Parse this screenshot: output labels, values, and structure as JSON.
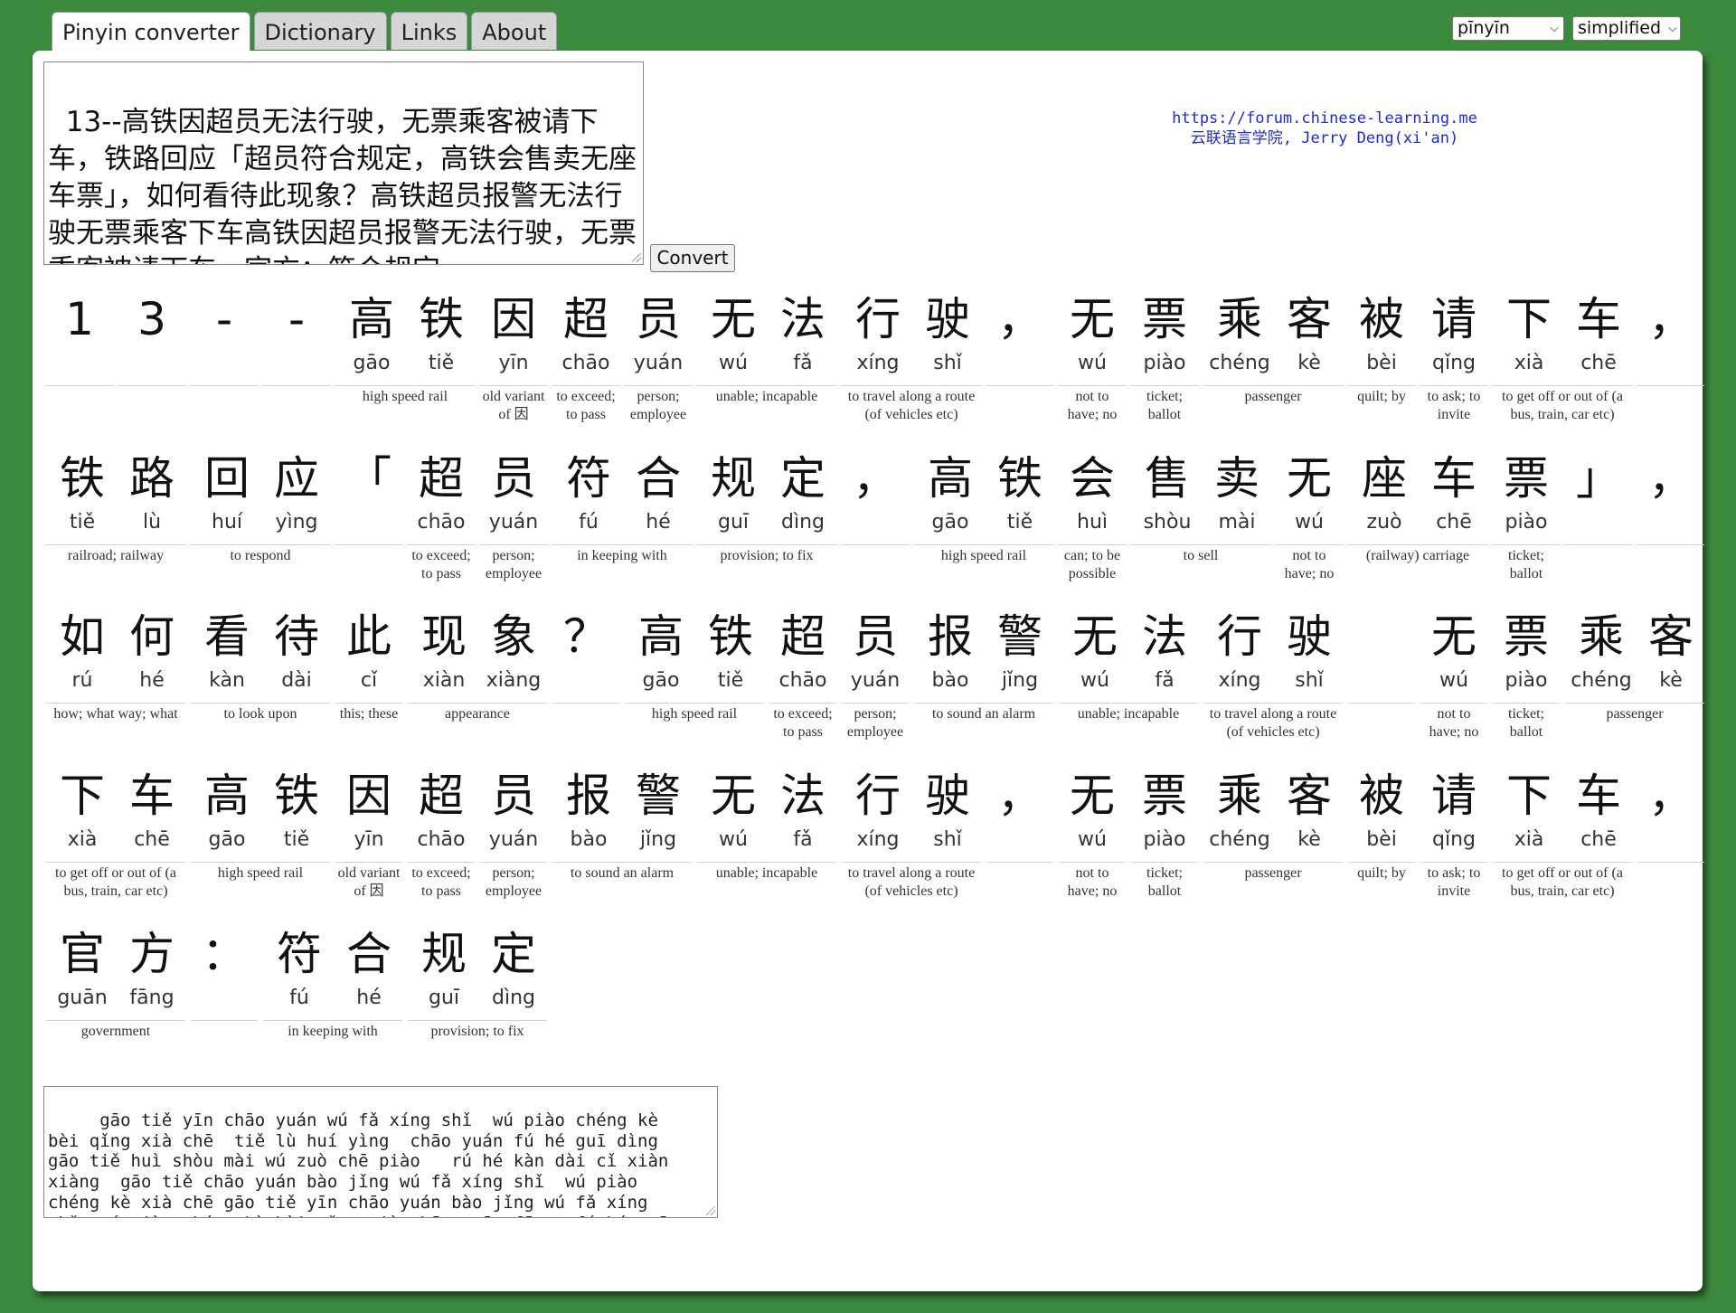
{
  "tabs": [
    {
      "label": "Pinyin converter",
      "active": true
    },
    {
      "label": "Dictionary",
      "active": false
    },
    {
      "label": "Links",
      "active": false
    },
    {
      "label": "About",
      "active": false
    }
  ],
  "controls": {
    "romanization_select": "pīnyīn",
    "script_select": "simplified",
    "convert_button": "Convert"
  },
  "input_text": "13--高铁因超员无法行驶，无票乘客被请下车，铁路回应「超员符合规定，高铁会售卖无座车票」，如何看待此现象？高铁超员报警无法行驶无票乘客下车高铁因超员报警无法行驶，无票乘客被请下车，官方：符合规定",
  "credit": {
    "url": "https://forum.chinese-learning.me",
    "author": "云联语言学院, Jerry Deng(xi'an)"
  },
  "rows": [
    [
      {
        "chars": [
          {
            "h": "1",
            "p": ""
          }
        ],
        "gloss": ""
      },
      {
        "chars": [
          {
            "h": "3",
            "p": ""
          }
        ],
        "gloss": ""
      },
      {
        "chars": [
          {
            "h": "-",
            "p": ""
          }
        ],
        "gloss": ""
      },
      {
        "chars": [
          {
            "h": "-",
            "p": ""
          }
        ],
        "gloss": ""
      },
      {
        "chars": [
          {
            "h": "高",
            "p": "gāo"
          },
          {
            "h": "铁",
            "p": "tiě"
          }
        ],
        "gloss": "high speed rail"
      },
      {
        "chars": [
          {
            "h": "因",
            "p": "yīn"
          }
        ],
        "gloss": "old variant of 因"
      },
      {
        "chars": [
          {
            "h": "超",
            "p": "chāo"
          }
        ],
        "gloss": "to exceed; to pass"
      },
      {
        "chars": [
          {
            "h": "员",
            "p": "yuán"
          }
        ],
        "gloss": "person; employee"
      },
      {
        "chars": [
          {
            "h": "无",
            "p": "wú"
          },
          {
            "h": "法",
            "p": "fǎ"
          }
        ],
        "gloss": "unable; incapable"
      },
      {
        "chars": [
          {
            "h": "行",
            "p": "xíng"
          },
          {
            "h": "驶",
            "p": "shǐ"
          }
        ],
        "gloss": "to travel along a route (of vehicles etc)"
      },
      {
        "chars": [
          {
            "h": "，",
            "p": ""
          }
        ],
        "gloss": ""
      },
      {
        "chars": [
          {
            "h": "无",
            "p": "wú"
          }
        ],
        "gloss": "not to have; no"
      },
      {
        "chars": [
          {
            "h": "票",
            "p": "piào"
          }
        ],
        "gloss": "ticket; ballot"
      },
      {
        "chars": [
          {
            "h": "乘",
            "p": "chéng"
          },
          {
            "h": "客",
            "p": "kè"
          }
        ],
        "gloss": "passenger"
      },
      {
        "chars": [
          {
            "h": "被",
            "p": "bèi"
          }
        ],
        "gloss": "quilt; by"
      },
      {
        "chars": [
          {
            "h": "请",
            "p": "qǐng"
          }
        ],
        "gloss": "to ask; to invite"
      },
      {
        "chars": [
          {
            "h": "下",
            "p": "xià"
          },
          {
            "h": "车",
            "p": "chē"
          }
        ],
        "gloss": "to get off or out of (a bus, train, car etc)"
      },
      {
        "chars": [
          {
            "h": "，",
            "p": ""
          }
        ],
        "gloss": ""
      }
    ],
    [
      {
        "chars": [
          {
            "h": "铁",
            "p": "tiě"
          },
          {
            "h": "路",
            "p": "lù"
          }
        ],
        "gloss": "railroad; railway"
      },
      {
        "chars": [
          {
            "h": "回",
            "p": "huí"
          },
          {
            "h": "应",
            "p": "yìng"
          }
        ],
        "gloss": "to respond"
      },
      {
        "chars": [
          {
            "h": "「",
            "p": ""
          }
        ],
        "gloss": ""
      },
      {
        "chars": [
          {
            "h": "超",
            "p": "chāo"
          }
        ],
        "gloss": "to exceed; to pass"
      },
      {
        "chars": [
          {
            "h": "员",
            "p": "yuán"
          }
        ],
        "gloss": "person; employee"
      },
      {
        "chars": [
          {
            "h": "符",
            "p": "fú"
          },
          {
            "h": "合",
            "p": "hé"
          }
        ],
        "gloss": "in keeping with"
      },
      {
        "chars": [
          {
            "h": "规",
            "p": "guī"
          },
          {
            "h": "定",
            "p": "dìng"
          }
        ],
        "gloss": "provision; to fix"
      },
      {
        "chars": [
          {
            "h": "，",
            "p": ""
          }
        ],
        "gloss": ""
      },
      {
        "chars": [
          {
            "h": "高",
            "p": "gāo"
          },
          {
            "h": "铁",
            "p": "tiě"
          }
        ],
        "gloss": "high speed rail"
      },
      {
        "chars": [
          {
            "h": "会",
            "p": "huì"
          }
        ],
        "gloss": "can; to be possible"
      },
      {
        "chars": [
          {
            "h": "售",
            "p": "shòu"
          },
          {
            "h": "卖",
            "p": "mài"
          }
        ],
        "gloss": "to sell"
      },
      {
        "chars": [
          {
            "h": "无",
            "p": "wú"
          }
        ],
        "gloss": "not to have; no"
      },
      {
        "chars": [
          {
            "h": "座",
            "p": "zuò"
          },
          {
            "h": "车",
            "p": "chē"
          }
        ],
        "gloss": "(railway) carriage"
      },
      {
        "chars": [
          {
            "h": "票",
            "p": "piào"
          }
        ],
        "gloss": "ticket; ballot"
      },
      {
        "chars": [
          {
            "h": "」",
            "p": ""
          }
        ],
        "gloss": ""
      },
      {
        "chars": [
          {
            "h": "，",
            "p": ""
          }
        ],
        "gloss": ""
      }
    ],
    [
      {
        "chars": [
          {
            "h": "如",
            "p": "rú"
          },
          {
            "h": "何",
            "p": "hé"
          }
        ],
        "gloss": "how; what way; what"
      },
      {
        "chars": [
          {
            "h": "看",
            "p": "kàn"
          },
          {
            "h": "待",
            "p": "dài"
          }
        ],
        "gloss": "to look upon"
      },
      {
        "chars": [
          {
            "h": "此",
            "p": "cǐ"
          }
        ],
        "gloss": "this; these"
      },
      {
        "chars": [
          {
            "h": "现",
            "p": "xiàn"
          },
          {
            "h": "象",
            "p": "xiàng"
          }
        ],
        "gloss": "appearance"
      },
      {
        "chars": [
          {
            "h": "？",
            "p": ""
          }
        ],
        "gloss": ""
      },
      {
        "chars": [
          {
            "h": "高",
            "p": "gāo"
          },
          {
            "h": "铁",
            "p": "tiě"
          }
        ],
        "gloss": "high speed rail"
      },
      {
        "chars": [
          {
            "h": "超",
            "p": "chāo"
          }
        ],
        "gloss": "to exceed; to pass"
      },
      {
        "chars": [
          {
            "h": "员",
            "p": "yuán"
          }
        ],
        "gloss": "person; employee"
      },
      {
        "chars": [
          {
            "h": "报",
            "p": "bào"
          },
          {
            "h": "警",
            "p": "jǐng"
          }
        ],
        "gloss": "to sound an alarm"
      },
      {
        "chars": [
          {
            "h": "无",
            "p": "wú"
          },
          {
            "h": "法",
            "p": "fǎ"
          }
        ],
        "gloss": "unable; incapable"
      },
      {
        "chars": [
          {
            "h": "行",
            "p": "xíng"
          },
          {
            "h": "驶",
            "p": "shǐ"
          }
        ],
        "gloss": "to travel along a route (of vehicles etc)"
      },
      {
        "chars": [
          {
            "h": "",
            "p": ""
          }
        ],
        "gloss": ""
      },
      {
        "chars": [
          {
            "h": "无",
            "p": "wú"
          }
        ],
        "gloss": "not to have; no"
      },
      {
        "chars": [
          {
            "h": "票",
            "p": "piào"
          }
        ],
        "gloss": "ticket; ballot"
      },
      {
        "chars": [
          {
            "h": "乘",
            "p": "chéng"
          },
          {
            "h": "客",
            "p": "kè"
          }
        ],
        "gloss": "passenger"
      }
    ],
    [
      {
        "chars": [
          {
            "h": "下",
            "p": "xià"
          },
          {
            "h": "车",
            "p": "chē"
          }
        ],
        "gloss": "to get off or out of (a bus, train, car etc)"
      },
      {
        "chars": [
          {
            "h": "高",
            "p": "gāo"
          },
          {
            "h": "铁",
            "p": "tiě"
          }
        ],
        "gloss": "high speed rail"
      },
      {
        "chars": [
          {
            "h": "因",
            "p": "yīn"
          }
        ],
        "gloss": "old variant of 因"
      },
      {
        "chars": [
          {
            "h": "超",
            "p": "chāo"
          }
        ],
        "gloss": "to exceed; to pass"
      },
      {
        "chars": [
          {
            "h": "员",
            "p": "yuán"
          }
        ],
        "gloss": "person; employee"
      },
      {
        "chars": [
          {
            "h": "报",
            "p": "bào"
          },
          {
            "h": "警",
            "p": "jǐng"
          }
        ],
        "gloss": "to sound an alarm"
      },
      {
        "chars": [
          {
            "h": "无",
            "p": "wú"
          },
          {
            "h": "法",
            "p": "fǎ"
          }
        ],
        "gloss": "unable; incapable"
      },
      {
        "chars": [
          {
            "h": "行",
            "p": "xíng"
          },
          {
            "h": "驶",
            "p": "shǐ"
          }
        ],
        "gloss": "to travel along a route (of vehicles etc)"
      },
      {
        "chars": [
          {
            "h": "，",
            "p": ""
          }
        ],
        "gloss": ""
      },
      {
        "chars": [
          {
            "h": "无",
            "p": "wú"
          }
        ],
        "gloss": "not to have; no"
      },
      {
        "chars": [
          {
            "h": "票",
            "p": "piào"
          }
        ],
        "gloss": "ticket; ballot"
      },
      {
        "chars": [
          {
            "h": "乘",
            "p": "chéng"
          },
          {
            "h": "客",
            "p": "kè"
          }
        ],
        "gloss": "passenger"
      },
      {
        "chars": [
          {
            "h": "被",
            "p": "bèi"
          }
        ],
        "gloss": "quilt; by"
      },
      {
        "chars": [
          {
            "h": "请",
            "p": "qǐng"
          }
        ],
        "gloss": "to ask; to invite"
      },
      {
        "chars": [
          {
            "h": "下",
            "p": "xià"
          },
          {
            "h": "车",
            "p": "chē"
          }
        ],
        "gloss": "to get off or out of (a bus, train, car etc)"
      },
      {
        "chars": [
          {
            "h": "，",
            "p": ""
          }
        ],
        "gloss": ""
      }
    ],
    [
      {
        "chars": [
          {
            "h": "官",
            "p": "guān"
          },
          {
            "h": "方",
            "p": "fāng"
          }
        ],
        "gloss": "government"
      },
      {
        "chars": [
          {
            "h": "：",
            "p": ""
          }
        ],
        "gloss": ""
      },
      {
        "chars": [
          {
            "h": "符",
            "p": "fú"
          },
          {
            "h": "合",
            "p": "hé"
          }
        ],
        "gloss": "in keeping with"
      },
      {
        "chars": [
          {
            "h": "规",
            "p": "guī"
          },
          {
            "h": "定",
            "p": "dìng"
          }
        ],
        "gloss": "provision; to fix"
      }
    ]
  ],
  "output_pinyin": "   gāo tiě yīn chāo yuán wú fǎ xíng shǐ  wú piào chéng kè\nbèi qǐng xià chē  tiě lù huí yìng  chāo yuán fú hé guī dìng\ngāo tiě huì shòu mài wú zuò chē piào   rú hé kàn dài cǐ xiàn\nxiàng  gāo tiě chāo yuán bào jǐng wú fǎ xíng shǐ  wú piào\nchéng kè xià chē gāo tiě yīn chāo yuán bào jǐng wú fǎ xíng\nshǐ  wú piào chéng kè bèi qǐng xià chē  guān fāng  fú hé guī"
}
